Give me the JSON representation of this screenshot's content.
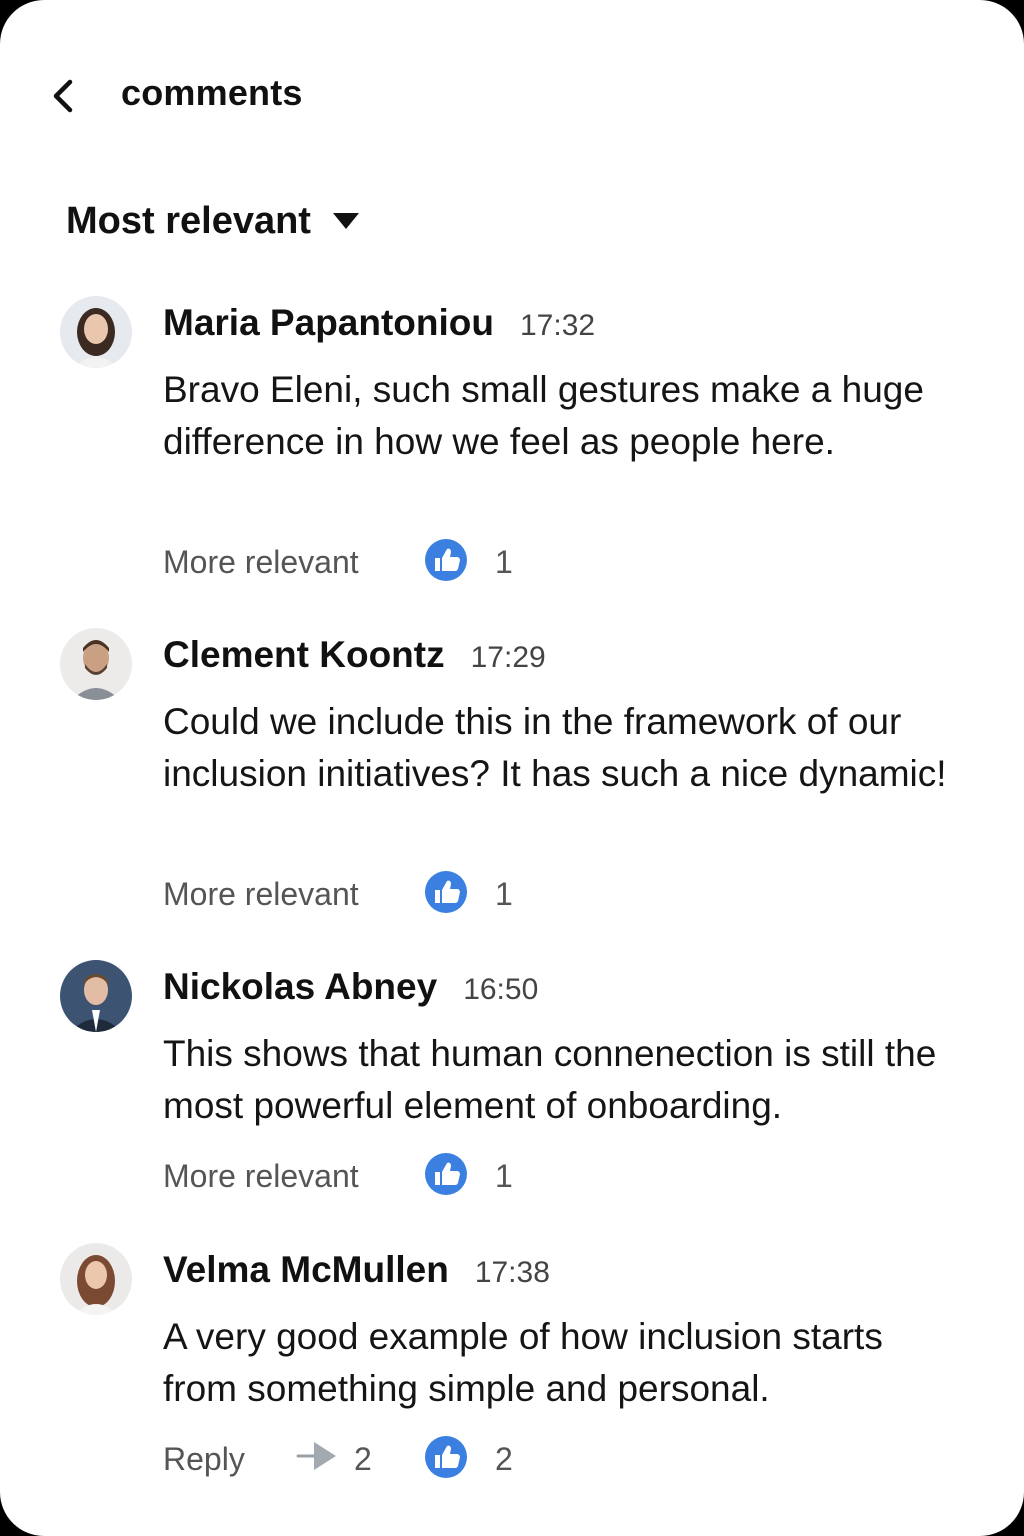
{
  "header": {
    "title": "comments",
    "back_icon": "chevron-left-icon"
  },
  "sort": {
    "label": "Most relevant",
    "icon": "caret-down-icon"
  },
  "colors": {
    "like_blue": "#3b7fe0",
    "text_primary": "#111111",
    "text_secondary": "#555555"
  },
  "comments": [
    {
      "author": "Maria Papantoniou",
      "time": "17:32",
      "text": "Bravo Eleni, such small gestures make a huge difference in how we feel as people here.",
      "action_label": "More relevant",
      "likes": "1"
    },
    {
      "author": "Clement Koontz",
      "time": "17:29",
      "text": "Could we include this in the framework of our inclusion initiatives? It has such a nice dynamic!",
      "action_label": "More relevant",
      "likes": "1"
    },
    {
      "author": "Nickolas Abney",
      "time": "16:50",
      "text": "This shows that human connenection is still the most powerful element of onboarding.",
      "action_label": "More relevant",
      "likes": "1"
    },
    {
      "author": "Velma McMullen",
      "time": "17:38",
      "text": "A very good example of how inclusion starts from something simple and personal.",
      "action_label": "Reply",
      "replies": "2",
      "likes": "2"
    }
  ]
}
